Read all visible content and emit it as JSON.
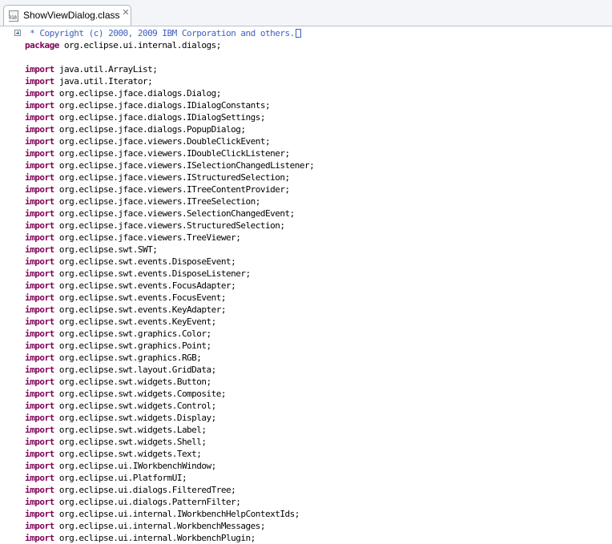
{
  "tab": {
    "label": "ShowViewDialog.class",
    "file_icon": "class-file-icon",
    "close_icon": "close-icon"
  },
  "editor": {
    "fold_icon": "expand-plus-icon",
    "header_comment": " * Copyright (c) 2000, 2009 IBM Corporation and others.",
    "package_keyword": "package",
    "package_name": " org.eclipse.ui.internal.dialogs;",
    "import_keyword": "import",
    "imports": [
      "java.util.ArrayList;",
      "java.util.Iterator;",
      "org.eclipse.jface.dialogs.Dialog;",
      "org.eclipse.jface.dialogs.IDialogConstants;",
      "org.eclipse.jface.dialogs.IDialogSettings;",
      "org.eclipse.jface.dialogs.PopupDialog;",
      "org.eclipse.jface.viewers.DoubleClickEvent;",
      "org.eclipse.jface.viewers.IDoubleClickListener;",
      "org.eclipse.jface.viewers.ISelectionChangedListener;",
      "org.eclipse.jface.viewers.IStructuredSelection;",
      "org.eclipse.jface.viewers.ITreeContentProvider;",
      "org.eclipse.jface.viewers.ITreeSelection;",
      "org.eclipse.jface.viewers.SelectionChangedEvent;",
      "org.eclipse.jface.viewers.StructuredSelection;",
      "org.eclipse.jface.viewers.TreeViewer;",
      "org.eclipse.swt.SWT;",
      "org.eclipse.swt.events.DisposeEvent;",
      "org.eclipse.swt.events.DisposeListener;",
      "org.eclipse.swt.events.FocusAdapter;",
      "org.eclipse.swt.events.FocusEvent;",
      "org.eclipse.swt.events.KeyAdapter;",
      "org.eclipse.swt.events.KeyEvent;",
      "org.eclipse.swt.graphics.Color;",
      "org.eclipse.swt.graphics.Point;",
      "org.eclipse.swt.graphics.RGB;",
      "org.eclipse.swt.layout.GridData;",
      "org.eclipse.swt.widgets.Button;",
      "org.eclipse.swt.widgets.Composite;",
      "org.eclipse.swt.widgets.Control;",
      "org.eclipse.swt.widgets.Display;",
      "org.eclipse.swt.widgets.Label;",
      "org.eclipse.swt.widgets.Shell;",
      "org.eclipse.swt.widgets.Text;",
      "org.eclipse.ui.IWorkbenchWindow;",
      "org.eclipse.ui.PlatformUI;",
      "org.eclipse.ui.dialogs.FilteredTree;",
      "org.eclipse.ui.dialogs.PatternFilter;",
      "org.eclipse.ui.internal.IWorkbenchHelpContextIds;",
      "org.eclipse.ui.internal.WorkbenchMessages;",
      "org.eclipse.ui.internal.WorkbenchPlugin;"
    ]
  }
}
